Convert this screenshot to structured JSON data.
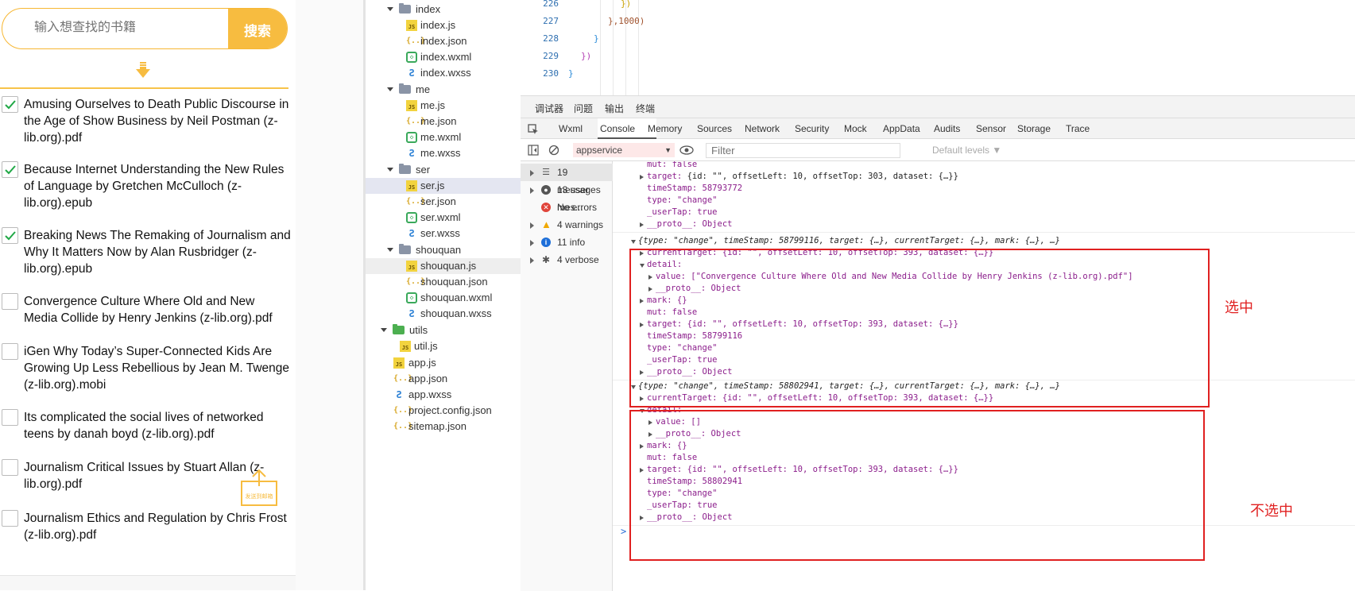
{
  "phone": {
    "search": {
      "placeholder": "输入想查找的书籍",
      "button": "搜索"
    },
    "books": [
      {
        "title": "Amusing Ourselves to Death Public Discourse in the Age of Show Business by Neil Postman (z-lib.org).pdf",
        "checked": true
      },
      {
        "title": "Because Internet Understanding the New Rules of Language by Gretchen McCulloch (z-lib.org).epub",
        "checked": true
      },
      {
        "title": "Breaking News The Remaking of Journalism and Why It Matters Now by Alan Rusbridger (z-lib.org).epub",
        "checked": true
      },
      {
        "title": "Convergence Culture Where Old and New Media Collide by Henry Jenkins (z-lib.org).pdf",
        "checked": false
      },
      {
        "title": "iGen Why Today’s Super-Connected Kids Are Growing Up Less Rebellious by Jean M. Twenge (z-lib.org).mobi",
        "checked": false
      },
      {
        "title": "Its complicated the social lives of networked teens by danah boyd (z-lib.org).pdf",
        "checked": false
      },
      {
        "title": "Journalism Critical Issues by Stuart Allan (z-lib.org).pdf",
        "checked": false
      },
      {
        "title": "Journalism Ethics and Regulation by Chris Frost (z-lib.org).pdf",
        "checked": false
      }
    ],
    "share_label": "发送到邮箱"
  },
  "tree": {
    "index": "index",
    "index_js": "index.js",
    "index_json": "index.json",
    "index_wxml": "index.wxml",
    "index_wxss": "index.wxss",
    "me": "me",
    "me_js": "me.js",
    "me_json": "me.json",
    "me_wxml": "me.wxml",
    "me_wxss": "me.wxss",
    "ser": "ser",
    "ser_js": "ser.js",
    "ser_json": "ser.json",
    "ser_wxml": "ser.wxml",
    "ser_wxss": "ser.wxss",
    "shouquan": "shouquan",
    "shouquan_js": "shouquan.js",
    "shouquan_json": "shouquan.json",
    "shouquan_wxml": "shouquan.wxml",
    "shouquan_wxss": "shouquan.wxss",
    "utils": "utils",
    "util_js": "util.js",
    "app_js": "app.js",
    "app_json": "app.json",
    "app_wxss": "app.wxss",
    "project_config": "project.config.json",
    "sitemap": "sitemap.json"
  },
  "code": {
    "lines": [
      {
        "n": "226",
        "text": "})"
      },
      {
        "n": "227",
        "text": "},1000)"
      },
      {
        "n": "228",
        "text": "}"
      },
      {
        "n": "229",
        "text": "})"
      },
      {
        "n": "230",
        "text": "}"
      }
    ]
  },
  "devtools": {
    "top_tabs": [
      "调试器",
      "问题",
      "输出",
      "终端"
    ],
    "panel_tabs": [
      "Wxml",
      "Console",
      "Memory",
      "Sources",
      "Network",
      "Security",
      "Mock",
      "AppData",
      "Audits",
      "Sensor",
      "Storage",
      "Trace"
    ],
    "context": "appservice",
    "filter_placeholder": "Filter",
    "levels": "Default levels ▼",
    "sidebar": [
      {
        "label": "19 messages",
        "icon": "list-icon"
      },
      {
        "label": "13 user mes...",
        "icon": "user-icon"
      },
      {
        "label": "No errors",
        "icon": "error-icon"
      },
      {
        "label": "4 warnings",
        "icon": "warning-icon"
      },
      {
        "label": "11 info",
        "icon": "info-icon"
      },
      {
        "label": "4 verbose",
        "icon": "verbose-icon"
      }
    ],
    "log": {
      "l1": "mut: false",
      "l2_key": "target: ",
      "l2_val": "{id: \"\", offsetLeft: 10, offsetTop: 303, dataset: {…}}",
      "l3": "timeStamp: 58793772",
      "l4": "type: \"change\"",
      "l5": "_userTap: true",
      "l6": "__proto__: Object",
      "e1_head": "{type: \"change\", timeStamp: 58799116, target: {…}, currentTarget: {…}, mark: {…}, …}",
      "e1_ct": "currentTarget: {id: \"\", offsetLeft: 10, offsetTop: 393, dataset: {…}}",
      "e1_detail": "detail:",
      "e1_value": "value: [\"Convergence Culture Where Old and New Media Collide by Henry Jenkins (z-lib.org).pdf\"]",
      "e1_proto": "__proto__: Object",
      "e1_mark": "mark: {}",
      "e1_mut": "mut: false",
      "e1_target": "target: {id: \"\", offsetLeft: 10, offsetTop: 393, dataset: {…}}",
      "e1_ts": "timeStamp: 58799116",
      "e1_type": "type: \"change\"",
      "e1_tap": "_userTap: true",
      "e1_proto2": "__proto__: Object",
      "e2_head": "{type: \"change\", timeStamp: 58802941, target: {…}, currentTarget: {…}, mark: {…}, …}",
      "e2_ct": "currentTarget: {id: \"\", offsetLeft: 10, offsetTop: 393, dataset: {…}}",
      "e2_detail": "detail:",
      "e2_value": "value: []",
      "e2_proto": "__proto__: Object",
      "e2_mark": "mark: {}",
      "e2_mut": "mut: false",
      "e2_target": "target: {id: \"\", offsetLeft: 10, offsetTop: 393, dataset: {…}}",
      "e2_ts": "timeStamp: 58802941",
      "e2_type": "type: \"change\"",
      "e2_tap": "_userTap: true",
      "e2_proto2": "__proto__: Object",
      "prompt": ">"
    },
    "annotations": {
      "selected": "选中",
      "unselected": "不选中"
    }
  },
  "colors": {
    "accent": "#f7bc40",
    "annotation": "#e02020"
  }
}
